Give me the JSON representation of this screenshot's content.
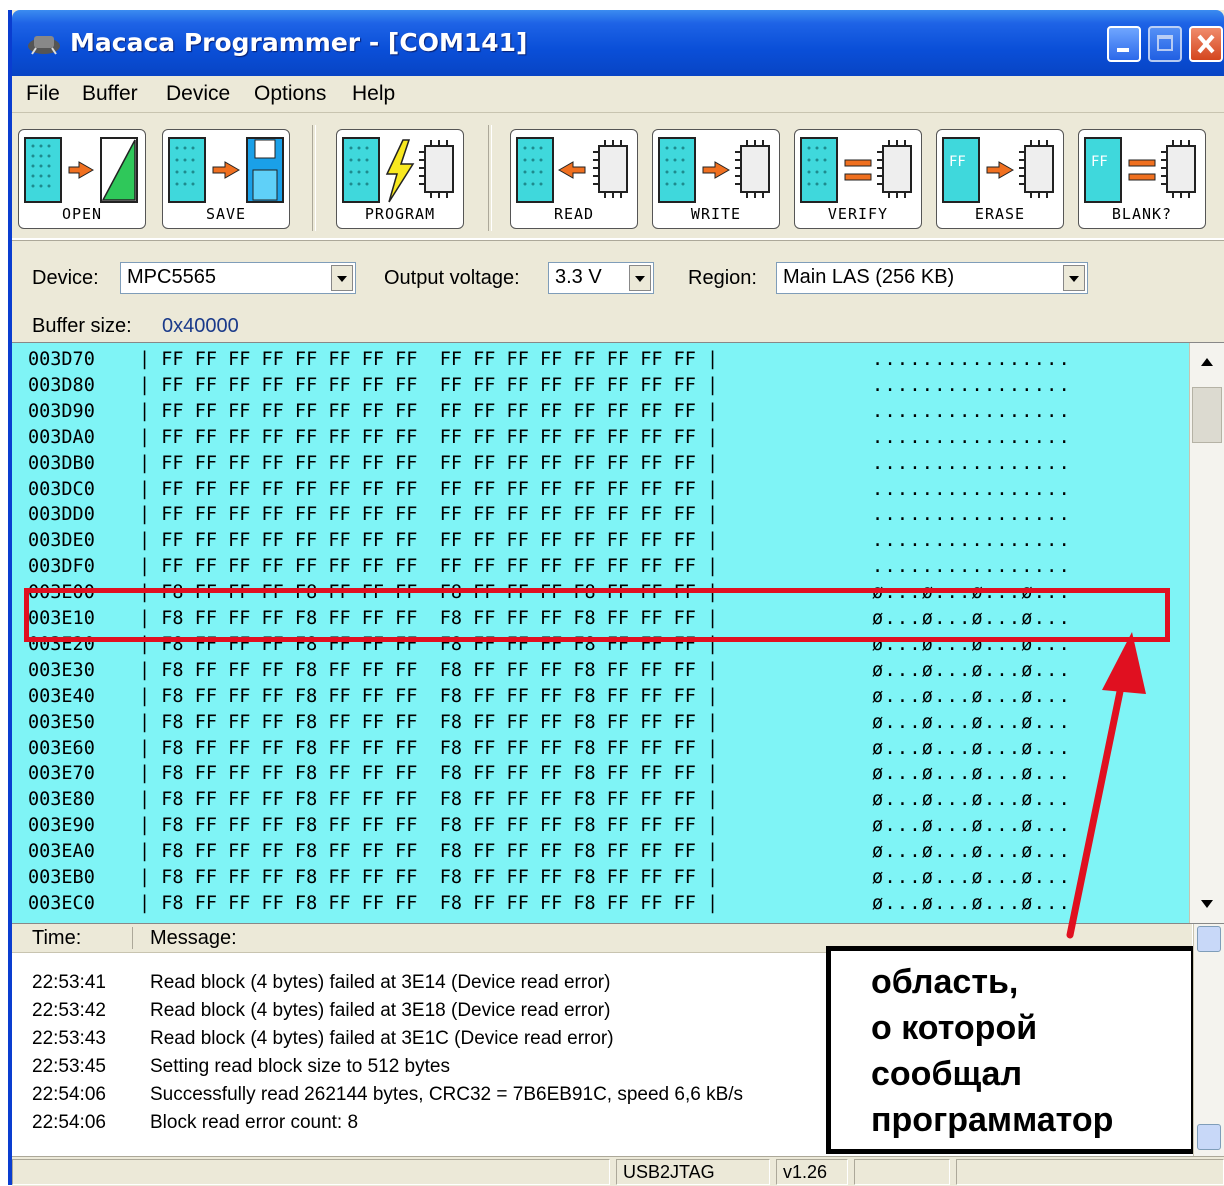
{
  "window": {
    "title": "Macaca Programmer - [COM141]"
  },
  "menu": [
    "File",
    "Buffer",
    "Device",
    "Options",
    "Help"
  ],
  "toolbar": {
    "buttons": [
      "OPEN",
      "SAVE",
      "PROGRAM",
      "READ",
      "WRITE",
      "VERIFY",
      "ERASE",
      "BLANK?"
    ],
    "ff_label": "FF"
  },
  "device": {
    "device_label": "Device:",
    "device_value": "MPC5565",
    "voltage_label": "Output voltage:",
    "voltage_value": "3.3 V",
    "region_label": "Region:",
    "region_value": "Main LAS (256 KB)",
    "buffer_label": "Buffer size:",
    "buffer_value": "0x40000"
  },
  "hex": {
    "rows": [
      {
        "addr": "003D70",
        "bytes": "| FF FF FF FF FF FF FF FF  FF FF FF FF FF FF FF FF |",
        "ascii": "................"
      },
      {
        "addr": "003D80",
        "bytes": "| FF FF FF FF FF FF FF FF  FF FF FF FF FF FF FF FF |",
        "ascii": "................"
      },
      {
        "addr": "003D90",
        "bytes": "| FF FF FF FF FF FF FF FF  FF FF FF FF FF FF FF FF |",
        "ascii": "................"
      },
      {
        "addr": "003DA0",
        "bytes": "| FF FF FF FF FF FF FF FF  FF FF FF FF FF FF FF FF |",
        "ascii": "................"
      },
      {
        "addr": "003DB0",
        "bytes": "| FF FF FF FF FF FF FF FF  FF FF FF FF FF FF FF FF |",
        "ascii": "................"
      },
      {
        "addr": "003DC0",
        "bytes": "| FF FF FF FF FF FF FF FF  FF FF FF FF FF FF FF FF |",
        "ascii": "................"
      },
      {
        "addr": "003DD0",
        "bytes": "| FF FF FF FF FF FF FF FF  FF FF FF FF FF FF FF FF |",
        "ascii": "................"
      },
      {
        "addr": "003DE0",
        "bytes": "| FF FF FF FF FF FF FF FF  FF FF FF FF FF FF FF FF |",
        "ascii": "................"
      },
      {
        "addr": "003DF0",
        "bytes": "| FF FF FF FF FF FF FF FF  FF FF FF FF FF FF FF FF |",
        "ascii": "................"
      },
      {
        "addr": "003E00",
        "bytes": "| F8 FF FF FF F8 FF FF FF  F8 FF FF FF F8 FF FF FF |",
        "ascii": "ø...ø...ø...ø..."
      },
      {
        "addr": "003E10",
        "bytes": "| F8 FF FF FF F8 FF FF FF  F8 FF FF FF F8 FF FF FF |",
        "ascii": "ø...ø...ø...ø..."
      },
      {
        "addr": "003E20",
        "bytes": "| F8 FF FF FF F8 FF FF FF  F8 FF FF FF F8 FF FF FF |",
        "ascii": "ø...ø...ø...ø..."
      },
      {
        "addr": "003E30",
        "bytes": "| F8 FF FF FF F8 FF FF FF  F8 FF FF FF F8 FF FF FF |",
        "ascii": "ø...ø...ø...ø..."
      },
      {
        "addr": "003E40",
        "bytes": "| F8 FF FF FF F8 FF FF FF  F8 FF FF FF F8 FF FF FF |",
        "ascii": "ø...ø...ø...ø..."
      },
      {
        "addr": "003E50",
        "bytes": "| F8 FF FF FF F8 FF FF FF  F8 FF FF FF F8 FF FF FF |",
        "ascii": "ø...ø...ø...ø..."
      },
      {
        "addr": "003E60",
        "bytes": "| F8 FF FF FF F8 FF FF FF  F8 FF FF FF F8 FF FF FF |",
        "ascii": "ø...ø...ø...ø..."
      },
      {
        "addr": "003E70",
        "bytes": "| F8 FF FF FF F8 FF FF FF  F8 FF FF FF F8 FF FF FF |",
        "ascii": "ø...ø...ø...ø..."
      },
      {
        "addr": "003E80",
        "bytes": "| F8 FF FF FF F8 FF FF FF  F8 FF FF FF F8 FF FF FF |",
        "ascii": "ø...ø...ø...ø..."
      },
      {
        "addr": "003E90",
        "bytes": "| F8 FF FF FF F8 FF FF FF  F8 FF FF FF F8 FF FF FF |",
        "ascii": "ø...ø...ø...ø..."
      },
      {
        "addr": "003EA0",
        "bytes": "| F8 FF FF FF F8 FF FF FF  F8 FF FF FF F8 FF FF FF |",
        "ascii": "ø...ø...ø...ø..."
      },
      {
        "addr": "003EB0",
        "bytes": "| F8 FF FF FF F8 FF FF FF  F8 FF FF FF F8 FF FF FF |",
        "ascii": "ø...ø...ø...ø..."
      },
      {
        "addr": "003EC0",
        "bytes": "| F8 FF FF FF F8 FF FF FF  F8 FF FF FF F8 FF FF FF |",
        "ascii": "ø...ø...ø...ø..."
      }
    ]
  },
  "log": {
    "time_header": "Time:",
    "message_header": "Message:",
    "entries": [
      {
        "time": "22:53:41",
        "message": "Read block (4 bytes) failed at 3E14 (Device read error)"
      },
      {
        "time": "22:53:42",
        "message": "Read block (4 bytes) failed at 3E18 (Device read error)"
      },
      {
        "time": "22:53:43",
        "message": "Read block (4 bytes) failed at 3E1C (Device read error)"
      },
      {
        "time": "22:53:45",
        "message": "Setting read block size to 512 bytes"
      },
      {
        "time": "22:54:06",
        "message": "Successfully read 262144 bytes, CRC32 = 7B6EB91C, speed 6,6 kB/s"
      },
      {
        "time": "22:54:06",
        "message": "Block read error count: 8"
      }
    ]
  },
  "annotation": {
    "lines": [
      "область,",
      "о которой",
      "сообщал",
      "программатор"
    ]
  },
  "status": {
    "interface": "USB2JTAG",
    "version": "v1.26"
  },
  "colors": {
    "hex_bg": "#7ff4f6",
    "highlight": "#e01020",
    "titlebar": "#0a4fd8"
  }
}
